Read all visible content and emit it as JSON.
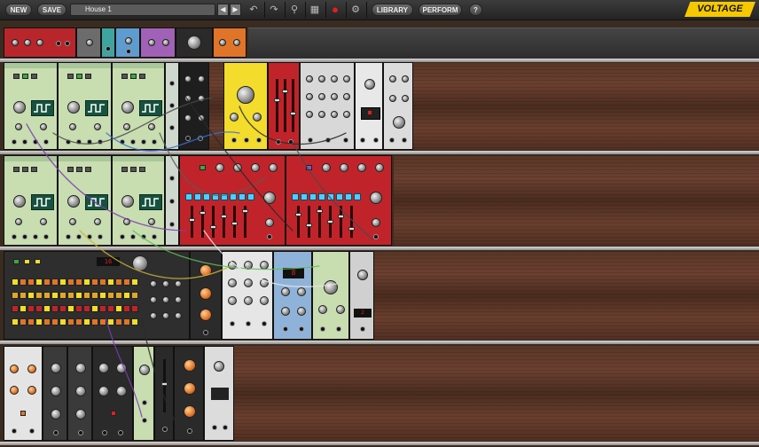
{
  "toolbar": {
    "new_label": "NEW",
    "save_label": "SAVE",
    "preset_name": "House 1",
    "library_label": "LIBRARY",
    "perform_label": "PERFORM",
    "help_label": "?",
    "logo_text": "VOLTAGE",
    "icons": [
      "prev-arrow-icon",
      "next-arrow-icon",
      "undo-icon",
      "redo-icon",
      "search-icon",
      "grid-icon",
      "record-icon",
      "gear-icon"
    ]
  },
  "colors": {
    "oscillator": "#c8ddb0",
    "sequencer": "#c0242a",
    "yellow_module": "#f3dc2b",
    "blue_module": "#8fb3d8",
    "logo": "#f5c800",
    "record": "#e02020"
  }
}
